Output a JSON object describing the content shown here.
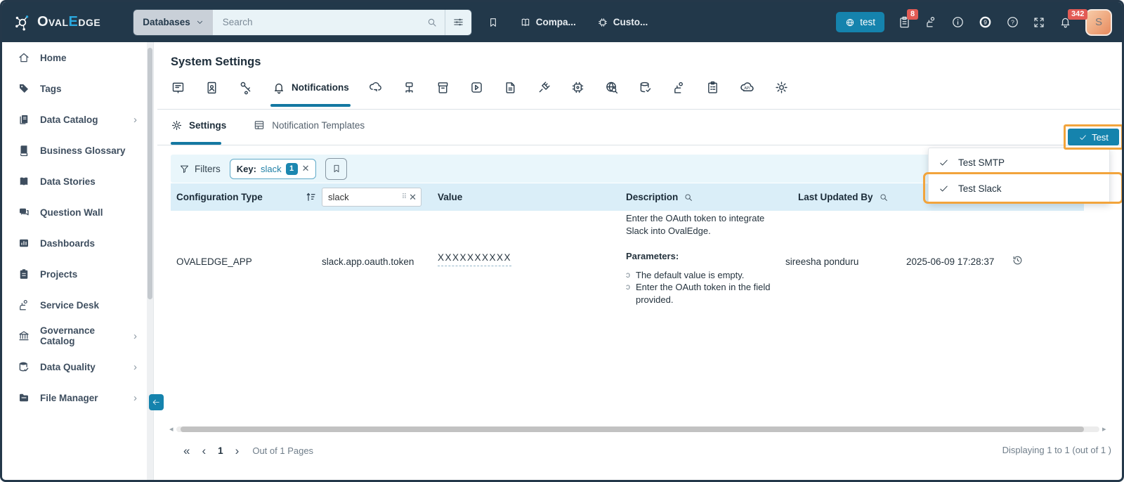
{
  "colors": {
    "accent": "#1583ad",
    "navbar_bg": "#22384a",
    "badge_red": "#e25b55",
    "annotation_orange": "#f2a43c",
    "header_row_bg": "#daeef8",
    "filter_bar_bg": "#e9f6fb",
    "logo_accent": "#2aa9e0"
  },
  "icons": {
    "pager_first": "«",
    "pager_prev": "‹",
    "pager_next": "›",
    "chevron_right": "›",
    "close": "✕",
    "bullet": "ɔ",
    "grip": "⠿",
    "left_arrow": "◂",
    "right_arrow": "▸"
  },
  "navbar": {
    "logo": {
      "part1": "Oval",
      "accent": "E",
      "part2": "dge"
    },
    "scope_select": {
      "value": "Databases"
    },
    "search": {
      "placeholder": "Search"
    },
    "links": [
      {
        "label": "Compa..."
      },
      {
        "label": "Custo..."
      }
    ],
    "session_button": {
      "label": "test"
    },
    "tasks_badge": "8",
    "alerts_badge": "342",
    "avatar_initial": "S"
  },
  "sidebar": {
    "items": [
      {
        "label": "Home"
      },
      {
        "label": "Tags"
      },
      {
        "label": "Data Catalog"
      },
      {
        "label": "Business Glossary"
      },
      {
        "label": "Data Stories"
      },
      {
        "label": "Question Wall"
      },
      {
        "label": "Dashboards"
      },
      {
        "label": "Projects"
      },
      {
        "label": "Service Desk"
      },
      {
        "label": "Governance Catalog"
      },
      {
        "label": "Data Quality"
      },
      {
        "label": "File Manager"
      }
    ]
  },
  "main": {
    "title": "System Settings",
    "active_icon_tab": {
      "label": "Notifications"
    },
    "sub_tabs": {
      "settings": "Settings",
      "templates": "Notification Templates"
    },
    "test_button": {
      "label": "Test"
    },
    "test_menu": {
      "items": [
        {
          "label": "Test SMTP"
        },
        {
          "label": "Test Slack"
        }
      ]
    },
    "filters": {
      "label": "Filters",
      "chip": {
        "name": "Key",
        "sep": ":",
        "value": "slack",
        "count": "1"
      }
    },
    "table": {
      "headers": {
        "configuration_type": "Configuration Type",
        "value": "Value",
        "description": "Description",
        "last_updated_by": "Last Updated By"
      },
      "key_filter_value": "slack",
      "rows": [
        {
          "configuration_type": "OVALEDGE_APP",
          "key": "slack.app.oauth.token",
          "value": "XXXXXXXXXX",
          "description": {
            "intro": "Enter the OAuth token to integrate Slack into OvalEdge.",
            "params_label": "Parameters:",
            "bullets": [
              "The default value is empty.",
              "Enter the OAuth token in the field provided."
            ]
          },
          "last_updated_by": "sireesha ponduru",
          "last_updated_date": "2025-06-09 17:28:37"
        }
      ]
    },
    "pagination": {
      "page": "1",
      "pages_label": "Out of 1 Pages",
      "displaying": "Displaying 1 to 1  (out of 1 )"
    }
  }
}
